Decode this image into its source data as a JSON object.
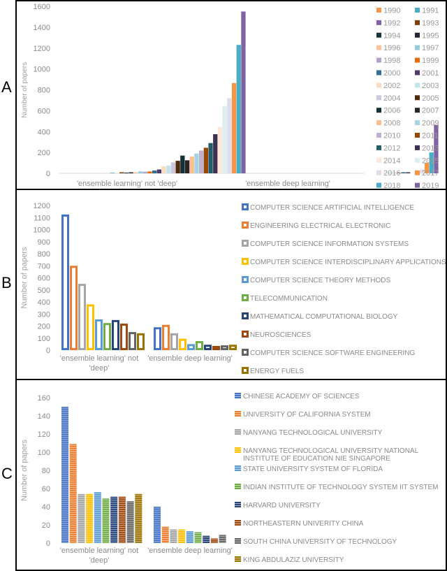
{
  "panels": {
    "A": {
      "letter": "A"
    },
    "B": {
      "letter": "B"
    },
    "C": {
      "letter": "C"
    }
  },
  "chart_data": [
    {
      "id": "A",
      "type": "bar",
      "title": "",
      "xlabel": "",
      "ylabel": "Number of papers",
      "ylim": [
        0,
        1600
      ],
      "yticks": [
        0,
        200,
        400,
        600,
        800,
        1000,
        1200,
        1400,
        1600
      ],
      "grid": false,
      "legend_position": "right",
      "categories": [
        "'ensemble learning' not 'deep'",
        "'ensemble deep learning'"
      ],
      "series": [
        {
          "name": "1990",
          "color": "#f79646",
          "values": [
            0,
            0
          ]
        },
        {
          "name": "1991",
          "color": "#4bacc6",
          "values": [
            5,
            0
          ]
        },
        {
          "name": "1992",
          "color": "#8064a2",
          "values": [
            0,
            0
          ]
        },
        {
          "name": "1993",
          "color": "#7b3f10",
          "values": [
            10,
            0
          ]
        },
        {
          "name": "1994",
          "color": "#17363f",
          "values": [
            7,
            0
          ]
        },
        {
          "name": "1995",
          "color": "#2a2236",
          "values": [
            10,
            0
          ]
        },
        {
          "name": "1996",
          "color": "#fbc49c",
          "values": [
            10,
            0
          ]
        },
        {
          "name": "1997",
          "color": "#93cddd",
          "values": [
            18,
            0
          ]
        },
        {
          "name": "1998",
          "color": "#b3a2c7",
          "values": [
            15,
            0
          ]
        },
        {
          "name": "1999",
          "color": "#e46c0a",
          "values": [
            18,
            0
          ]
        },
        {
          "name": "2000",
          "color": "#31708f",
          "values": [
            27,
            0
          ]
        },
        {
          "name": "2001",
          "color": "#4f3b70",
          "values": [
            37,
            0
          ]
        },
        {
          "name": "2002",
          "color": "#fcdcc0",
          "values": [
            67,
            0
          ]
        },
        {
          "name": "2003",
          "color": "#c4e5ee",
          "values": [
            75,
            2
          ]
        },
        {
          "name": "2004",
          "color": "#cdc6dc",
          "values": [
            105,
            0
          ]
        },
        {
          "name": "2005",
          "color": "#4e2a0c",
          "values": [
            120,
            0
          ]
        },
        {
          "name": "2006",
          "color": "#13303a",
          "values": [
            170,
            0
          ]
        },
        {
          "name": "2007",
          "color": "#262626",
          "values": [
            125,
            0
          ]
        },
        {
          "name": "2008",
          "color": "#fac090",
          "values": [
            160,
            3
          ]
        },
        {
          "name": "2009",
          "color": "#a5d5e2",
          "values": [
            190,
            5
          ]
        },
        {
          "name": "2010",
          "color": "#bfb0d4",
          "values": [
            218,
            5
          ]
        },
        {
          "name": "2011",
          "color": "#974806",
          "values": [
            245,
            5
          ]
        },
        {
          "name": "2012",
          "color": "#255e6b",
          "values": [
            290,
            10
          ]
        },
        {
          "name": "2013",
          "color": "#3f3151",
          "values": [
            375,
            10
          ]
        },
        {
          "name": "2014",
          "color": "#fde9d9",
          "values": [
            445,
            3
          ]
        },
        {
          "name": "2015",
          "color": "#daeef3",
          "values": [
            645,
            12
          ]
        },
        {
          "name": "2016",
          "color": "#e0dcea",
          "values": [
            720,
            35
          ]
        },
        {
          "name": "2017",
          "color": "#f79646",
          "values": [
            865,
            100
          ]
        },
        {
          "name": "2018",
          "color": "#4bacc6",
          "values": [
            1230,
            200
          ]
        },
        {
          "name": "2019",
          "color": "#8064a2",
          "values": [
            1550,
            465
          ]
        }
      ]
    },
    {
      "id": "B",
      "type": "bar",
      "style": "outlined",
      "title": "",
      "xlabel": "",
      "ylabel": "Number of papers",
      "ylim": [
        0,
        1200
      ],
      "yticks": [
        0,
        100,
        200,
        300,
        400,
        500,
        600,
        700,
        800,
        900,
        1000,
        1100,
        1200
      ],
      "grid": false,
      "legend_position": "right",
      "categories": [
        "'ensemble learning' not 'deep'",
        "'ensemble deep learning'"
      ],
      "series": [
        {
          "name": "COMPUTER SCIENCE ARTIFICIAL INTELLIGENCE",
          "color": "#4472c4",
          "values": [
            1125,
            190
          ]
        },
        {
          "name": "ENGINEERING ELECTRICAL ELECTRONIC",
          "color": "#ed7d31",
          "values": [
            700,
            210
          ]
        },
        {
          "name": "COMPUTER SCIENCE INFORMATION SYSTEMS",
          "color": "#a5a5a5",
          "values": [
            550,
            140
          ]
        },
        {
          "name": "COMPUTER SCIENCE INTERDISCIPLINARY APPLICATIONS",
          "color": "#ffc000",
          "values": [
            380,
            95
          ]
        },
        {
          "name": "COMPUTER SCIENCE THEORY METHODS",
          "color": "#5b9bd5",
          "values": [
            255,
            50
          ]
        },
        {
          "name": "TELECOMMUNICATION",
          "color": "#70ad47",
          "values": [
            225,
            75
          ]
        },
        {
          "name": "MATHEMATICAL COMPUTATIONAL BIOLOGY",
          "color": "#264478",
          "values": [
            250,
            45
          ]
        },
        {
          "name": "NEUROSCIENCES",
          "color": "#9e480e",
          "values": [
            220,
            35
          ]
        },
        {
          "name": "COMPUTER SCIENCE SOFTWARE ENGINEERING",
          "color": "#636363",
          "values": [
            150,
            40
          ]
        },
        {
          "name": "ENERGY FUELS",
          "color": "#997300",
          "values": [
            140,
            45
          ]
        }
      ]
    },
    {
      "id": "C",
      "type": "bar",
      "style": "striped",
      "title": "",
      "xlabel": "",
      "ylabel": "Number of papers",
      "ylim": [
        0,
        160
      ],
      "yticks": [
        0,
        20,
        40,
        60,
        80,
        100,
        120,
        140,
        160
      ],
      "grid": false,
      "legend_position": "right",
      "categories": [
        "'ensemble learning' not 'deep'",
        "'ensemble deep learning'"
      ],
      "series": [
        {
          "name": "CHINESE ACADEMY OF SCIENCES",
          "color": "#4472c4",
          "values": [
            150,
            40
          ]
        },
        {
          "name": "UNIVERSITY OF CALIFORNIA SYSTEM",
          "color": "#ed7d31",
          "values": [
            109,
            18
          ]
        },
        {
          "name": "NANYANG TECHNOLOGICAL UNIVERSITY",
          "color": "#a5a5a5",
          "values": [
            54,
            15
          ]
        },
        {
          "name": "NANYANG TECHNOLOGICAL UNIVERSITY NATIONAL INSTITUTE OF EDUCATION NIE SINGAPORE",
          "color": "#ffc000",
          "values": [
            54,
            15
          ]
        },
        {
          "name": "STATE UNIVERSITY SYSTEM OF FLORIDA",
          "color": "#5b9bd5",
          "values": [
            56,
            13
          ]
        },
        {
          "name": "INDIAN INSTITUTE OF TECHNOLOGY SYSTEM IIT SYSTEM",
          "color": "#70ad47",
          "values": [
            49,
            12
          ]
        },
        {
          "name": "HARVARD UNIVERSITY",
          "color": "#264478",
          "values": [
            51,
            8
          ]
        },
        {
          "name": "NORTHEASTERN UNIVERITY CHINA",
          "color": "#9e480e",
          "values": [
            51,
            5
          ]
        },
        {
          "name": "SOUTH CHINA UNIVERSITY OF TECHNOLOGY",
          "color": "#636363",
          "values": [
            46,
            9
          ]
        },
        {
          "name": "KING ABDULAZIZ UNIVERSITY",
          "color": "#997300",
          "values": [
            54,
            null
          ]
        }
      ]
    }
  ]
}
